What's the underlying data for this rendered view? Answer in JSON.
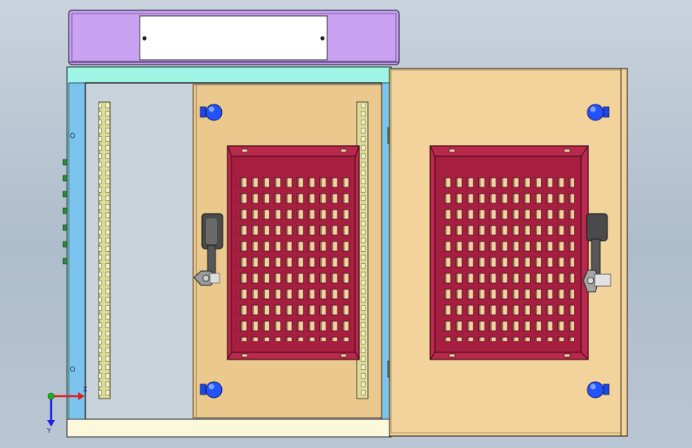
{
  "scene": {
    "description_type": "cad-viewport",
    "colors": {
      "background_top": "#c9d3dd",
      "background_bottom": "#aebdcc",
      "top_cover": "#c9a2f2",
      "label_plate": "#ffffff",
      "cabinet_frame": "#9ff5e3",
      "side_panel": "#7cc4ee",
      "interior_panel": "#eac88e",
      "din_rail": "#dddb9c",
      "vent_frame": "#b8294d",
      "door": "#f3d39c",
      "bolt": "#1e46e0",
      "handle": "#4a4a4a",
      "base": "#fbf8dc",
      "hinge": "#6b8a5e"
    },
    "axis": {
      "x_label": "X",
      "y_label": "Y",
      "x_color": "#e02020",
      "y_color": "#2020e0",
      "origin_color": "#20b020"
    },
    "icons": [
      "top-cover",
      "label-plate",
      "cabinet-body",
      "din-rail",
      "vent-grille",
      "door-handle",
      "mounting-bolt",
      "door-hinge",
      "coordinate-triad"
    ]
  }
}
